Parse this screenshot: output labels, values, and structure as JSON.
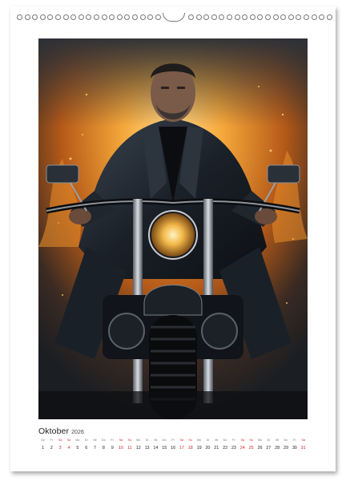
{
  "calendar": {
    "month": "Oktober",
    "year": "2026",
    "day_names": [
      "Do",
      "Fr",
      "Sa",
      "So",
      "Mo",
      "Di",
      "Mi",
      "Do",
      "Fr",
      "Sa",
      "So",
      "Mo",
      "Di",
      "Mi",
      "Do",
      "Fr",
      "Sa",
      "So",
      "Mo",
      "Di",
      "Mi",
      "Do",
      "Fr",
      "Sa",
      "So",
      "Mo",
      "Di",
      "Mi",
      "Do",
      "Fr",
      "Sa"
    ],
    "days": [
      "1",
      "2",
      "3",
      "4",
      "5",
      "6",
      "7",
      "8",
      "9",
      "10",
      "11",
      "12",
      "13",
      "14",
      "15",
      "16",
      "17",
      "18",
      "19",
      "20",
      "21",
      "22",
      "23",
      "24",
      "25",
      "26",
      "27",
      "28",
      "29",
      "30",
      "31"
    ],
    "weekend_color": "#d6252f"
  },
  "photo": {
    "subject": "biker-on-motorcycle-image",
    "palette": {
      "fire": "#f19a2b",
      "smoke": "#3a4048",
      "leather": "#14181c"
    }
  },
  "binding": {
    "hole_count_left": 19,
    "hole_count_right": 19
  }
}
